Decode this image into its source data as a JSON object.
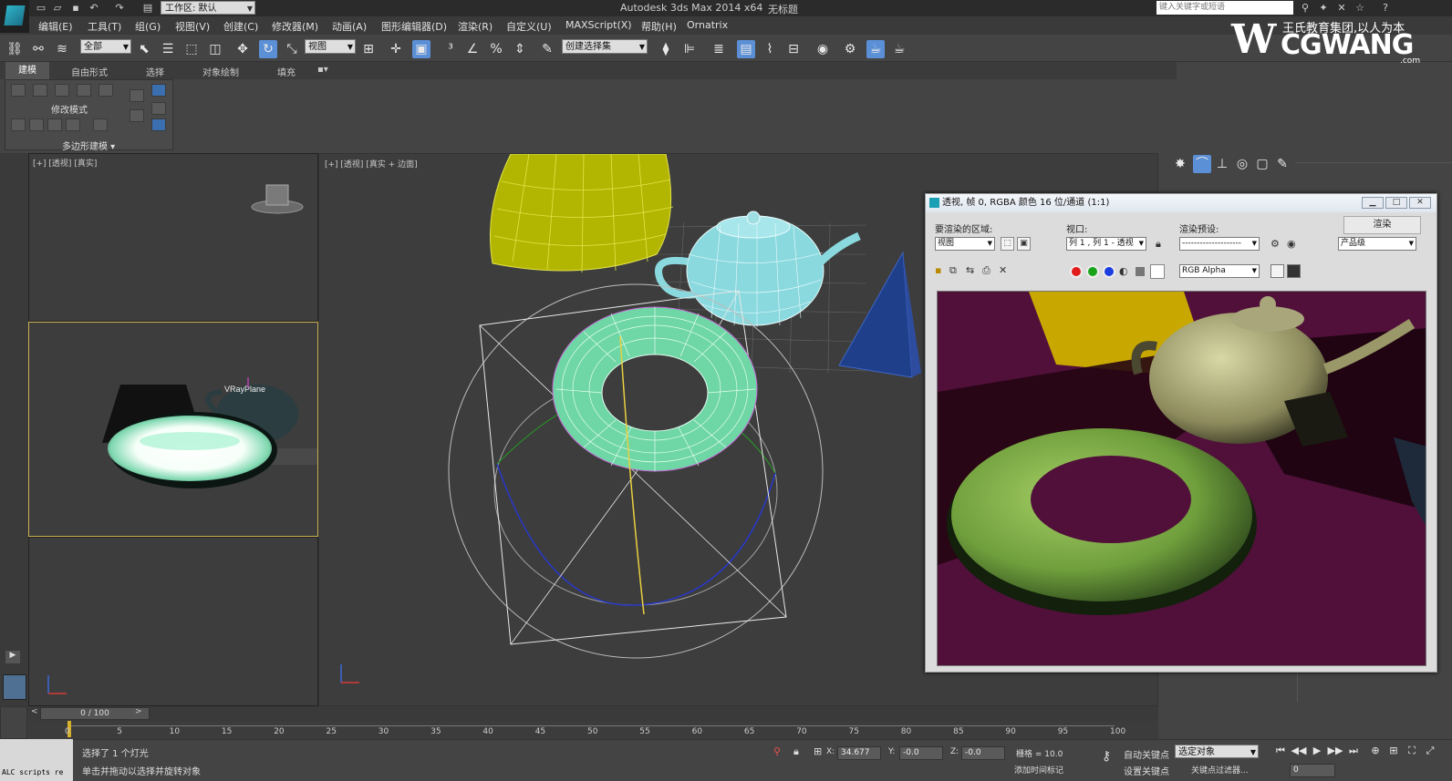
{
  "title_bar": {
    "workspace": "工作区: 默认",
    "app_title": "Autodesk 3ds Max  2014 x64",
    "doc_title": "无标题",
    "search_placeholder": "键入关键字或短语"
  },
  "menu": [
    "编辑(E)",
    "工具(T)",
    "组(G)",
    "视图(V)",
    "创建(C)",
    "修改器(M)",
    "动画(A)",
    "图形编辑器(D)",
    "渲染(R)",
    "自定义(U)",
    "MAXScript(X)",
    "帮助(H)",
    "Ornatrix"
  ],
  "toolbar": {
    "selection_filter": "全部",
    "reference_coord": "视图",
    "named_selection": "创建选择集"
  },
  "ribbon": {
    "tabs": [
      "建模",
      "自由形式",
      "选择",
      "对象绘制",
      "填充"
    ],
    "modify_mode_label": "修改模式",
    "poly_modeling_label": "多边形建模"
  },
  "viewports": {
    "top_left_label": "[+] [透视] [真实]",
    "mid_left_label": "",
    "main_label": "[+] [透视] [真实 + 边面]",
    "vray_plane_label": "VRayPlane"
  },
  "frame_buffer": {
    "title": "透视, 帧 0, RGBA 颜色 16 位/通道 (1:1)",
    "area_label": "要渲染的区域:",
    "area_value": "视图",
    "viewport_label": "视口:",
    "viewport_value": "列 1 , 列 1 - 透视",
    "preset_label": "渲染预设:",
    "preset_value": "--------------------",
    "render_button": "渲染",
    "quality_value": "产品级",
    "channel_value": "RGB Alpha"
  },
  "time": {
    "slider_label": "0 / 100",
    "ticks": [
      "0",
      "5",
      "10",
      "15",
      "20",
      "25",
      "30",
      "35",
      "40",
      "45",
      "50",
      "55",
      "60",
      "65",
      "70",
      "75",
      "80",
      "85",
      "90",
      "95",
      "100"
    ]
  },
  "status": {
    "maxscript": "ALC scripts re",
    "selection_status": "选择了 1 个灯光",
    "prompt": "单击并拖动以选择并旋转对象",
    "x_value": "34.677",
    "y_value": "-0.0",
    "z_value": "-0.0",
    "grid": "栅格 = 10.0",
    "auto_key": "自动关键点",
    "auto_key_filter": "选定对象",
    "set_key": "设置关键点",
    "key_filters": "关键点过滤器...",
    "add_time_tag": "添加时间标记",
    "frame_value": "0"
  },
  "logo": {
    "slogan": "王氏教育集团,以人为本",
    "name": "CGWANG",
    "domain": ".com"
  },
  "colors": {
    "torus_viewport": "#6fd6a5",
    "teapot_viewport": "#8ad9de",
    "cone_viewport": "#b3b600",
    "render_background": "#51103a",
    "render_torus": "#7fb44a"
  }
}
